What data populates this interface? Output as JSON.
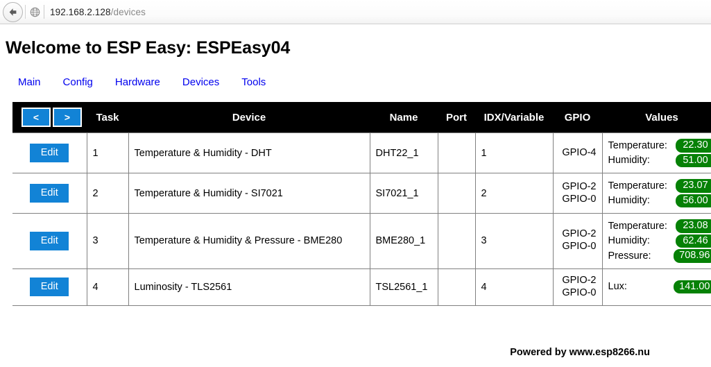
{
  "browser": {
    "back_icon": "back-arrow-icon",
    "site_icon": "globe-icon",
    "url_host": "192.168.2.128",
    "url_path": "/devices"
  },
  "page": {
    "title": "Welcome to ESP Easy: ESPEasy04",
    "footer": "Powered by www.esp8266.nu"
  },
  "nav": {
    "items": [
      {
        "label": "Main"
      },
      {
        "label": "Config"
      },
      {
        "label": "Hardware"
      },
      {
        "label": "Devices"
      },
      {
        "label": "Tools"
      }
    ]
  },
  "table": {
    "pager": {
      "prev": "<",
      "next": ">"
    },
    "headers": {
      "task": "Task",
      "device": "Device",
      "name": "Name",
      "port": "Port",
      "idx": "IDX/Variable",
      "gpio": "GPIO",
      "values": "Values"
    },
    "edit_label": "Edit",
    "rows": [
      {
        "task": "1",
        "device": "Temperature & Humidity - DHT",
        "name": "DHT22_1",
        "port": "",
        "idx": "1",
        "gpio": "GPIO-4",
        "values": [
          {
            "label": "Temperature:",
            "value": "22.30"
          },
          {
            "label": "Humidity:",
            "value": "51.00"
          }
        ]
      },
      {
        "task": "2",
        "device": "Temperature & Humidity - SI7021",
        "name": "SI7021_1",
        "port": "",
        "idx": "2",
        "gpio": "GPIO-2\nGPIO-0",
        "values": [
          {
            "label": "Temperature:",
            "value": "23.07"
          },
          {
            "label": "Humidity:",
            "value": "56.00"
          }
        ]
      },
      {
        "task": "3",
        "device": "Temperature & Humidity & Pressure - BME280",
        "name": "BME280_1",
        "port": "",
        "idx": "3",
        "gpio": "GPIO-2\nGPIO-0",
        "values": [
          {
            "label": "Temperature:",
            "value": "23.08"
          },
          {
            "label": "Humidity:",
            "value": "62.46"
          },
          {
            "label": "Pressure:",
            "value": "708.96"
          }
        ]
      },
      {
        "task": "4",
        "device": "Luminosity - TLS2561",
        "name": "TSL2561_1",
        "port": "",
        "idx": "4",
        "gpio": "GPIO-2\nGPIO-0",
        "values": [
          {
            "label": "Lux:",
            "value": "141.00"
          }
        ]
      }
    ]
  },
  "colors": {
    "accent_blue": "#1283d6",
    "link_blue": "#0000ee",
    "badge_green": "#068106",
    "header_black": "#000000"
  }
}
